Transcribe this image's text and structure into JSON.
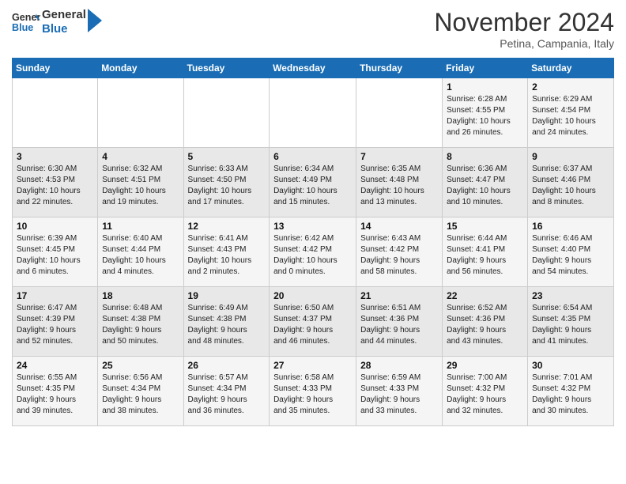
{
  "header": {
    "logo_line1": "General",
    "logo_line2": "Blue",
    "month": "November 2024",
    "location": "Petina, Campania, Italy"
  },
  "weekdays": [
    "Sunday",
    "Monday",
    "Tuesday",
    "Wednesday",
    "Thursday",
    "Friday",
    "Saturday"
  ],
  "weeks": [
    [
      {
        "day": "",
        "info": ""
      },
      {
        "day": "",
        "info": ""
      },
      {
        "day": "",
        "info": ""
      },
      {
        "day": "",
        "info": ""
      },
      {
        "day": "",
        "info": ""
      },
      {
        "day": "1",
        "info": "Sunrise: 6:28 AM\nSunset: 4:55 PM\nDaylight: 10 hours\nand 26 minutes."
      },
      {
        "day": "2",
        "info": "Sunrise: 6:29 AM\nSunset: 4:54 PM\nDaylight: 10 hours\nand 24 minutes."
      }
    ],
    [
      {
        "day": "3",
        "info": "Sunrise: 6:30 AM\nSunset: 4:53 PM\nDaylight: 10 hours\nand 22 minutes."
      },
      {
        "day": "4",
        "info": "Sunrise: 6:32 AM\nSunset: 4:51 PM\nDaylight: 10 hours\nand 19 minutes."
      },
      {
        "day": "5",
        "info": "Sunrise: 6:33 AM\nSunset: 4:50 PM\nDaylight: 10 hours\nand 17 minutes."
      },
      {
        "day": "6",
        "info": "Sunrise: 6:34 AM\nSunset: 4:49 PM\nDaylight: 10 hours\nand 15 minutes."
      },
      {
        "day": "7",
        "info": "Sunrise: 6:35 AM\nSunset: 4:48 PM\nDaylight: 10 hours\nand 13 minutes."
      },
      {
        "day": "8",
        "info": "Sunrise: 6:36 AM\nSunset: 4:47 PM\nDaylight: 10 hours\nand 10 minutes."
      },
      {
        "day": "9",
        "info": "Sunrise: 6:37 AM\nSunset: 4:46 PM\nDaylight: 10 hours\nand 8 minutes."
      }
    ],
    [
      {
        "day": "10",
        "info": "Sunrise: 6:39 AM\nSunset: 4:45 PM\nDaylight: 10 hours\nand 6 minutes."
      },
      {
        "day": "11",
        "info": "Sunrise: 6:40 AM\nSunset: 4:44 PM\nDaylight: 10 hours\nand 4 minutes."
      },
      {
        "day": "12",
        "info": "Sunrise: 6:41 AM\nSunset: 4:43 PM\nDaylight: 10 hours\nand 2 minutes."
      },
      {
        "day": "13",
        "info": "Sunrise: 6:42 AM\nSunset: 4:42 PM\nDaylight: 10 hours\nand 0 minutes."
      },
      {
        "day": "14",
        "info": "Sunrise: 6:43 AM\nSunset: 4:42 PM\nDaylight: 9 hours\nand 58 minutes."
      },
      {
        "day": "15",
        "info": "Sunrise: 6:44 AM\nSunset: 4:41 PM\nDaylight: 9 hours\nand 56 minutes."
      },
      {
        "day": "16",
        "info": "Sunrise: 6:46 AM\nSunset: 4:40 PM\nDaylight: 9 hours\nand 54 minutes."
      }
    ],
    [
      {
        "day": "17",
        "info": "Sunrise: 6:47 AM\nSunset: 4:39 PM\nDaylight: 9 hours\nand 52 minutes."
      },
      {
        "day": "18",
        "info": "Sunrise: 6:48 AM\nSunset: 4:38 PM\nDaylight: 9 hours\nand 50 minutes."
      },
      {
        "day": "19",
        "info": "Sunrise: 6:49 AM\nSunset: 4:38 PM\nDaylight: 9 hours\nand 48 minutes."
      },
      {
        "day": "20",
        "info": "Sunrise: 6:50 AM\nSunset: 4:37 PM\nDaylight: 9 hours\nand 46 minutes."
      },
      {
        "day": "21",
        "info": "Sunrise: 6:51 AM\nSunset: 4:36 PM\nDaylight: 9 hours\nand 44 minutes."
      },
      {
        "day": "22",
        "info": "Sunrise: 6:52 AM\nSunset: 4:36 PM\nDaylight: 9 hours\nand 43 minutes."
      },
      {
        "day": "23",
        "info": "Sunrise: 6:54 AM\nSunset: 4:35 PM\nDaylight: 9 hours\nand 41 minutes."
      }
    ],
    [
      {
        "day": "24",
        "info": "Sunrise: 6:55 AM\nSunset: 4:35 PM\nDaylight: 9 hours\nand 39 minutes."
      },
      {
        "day": "25",
        "info": "Sunrise: 6:56 AM\nSunset: 4:34 PM\nDaylight: 9 hours\nand 38 minutes."
      },
      {
        "day": "26",
        "info": "Sunrise: 6:57 AM\nSunset: 4:34 PM\nDaylight: 9 hours\nand 36 minutes."
      },
      {
        "day": "27",
        "info": "Sunrise: 6:58 AM\nSunset: 4:33 PM\nDaylight: 9 hours\nand 35 minutes."
      },
      {
        "day": "28",
        "info": "Sunrise: 6:59 AM\nSunset: 4:33 PM\nDaylight: 9 hours\nand 33 minutes."
      },
      {
        "day": "29",
        "info": "Sunrise: 7:00 AM\nSunset: 4:32 PM\nDaylight: 9 hours\nand 32 minutes."
      },
      {
        "day": "30",
        "info": "Sunrise: 7:01 AM\nSunset: 4:32 PM\nDaylight: 9 hours\nand 30 minutes."
      }
    ]
  ]
}
